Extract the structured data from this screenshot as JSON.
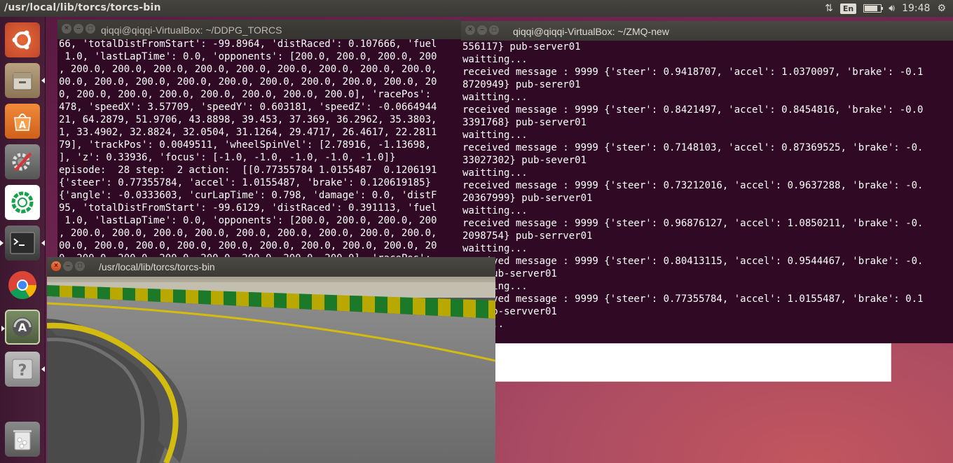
{
  "panel": {
    "title": "/usr/local/lib/torcs/torcs-bin",
    "lang": "En",
    "battery_level": 0.8,
    "volume_icon": "volume-icon",
    "clock": "19:48",
    "network_icon": "network-updown-icon",
    "power_icon": "power-gear-icon"
  },
  "launcher": [
    {
      "name": "ubuntu-dash-icon"
    },
    {
      "name": "files-icon"
    },
    {
      "name": "software-center-icon"
    },
    {
      "name": "system-settings-icon"
    },
    {
      "name": "green-app-icon"
    },
    {
      "name": "terminal-icon"
    },
    {
      "name": "chrome-icon"
    },
    {
      "name": "software-updater-icon"
    },
    {
      "name": "help-icon"
    },
    {
      "name": "trash-icon"
    }
  ],
  "term_left": {
    "title": "qiqqi@qiqqi-VirtualBox: ~/DDPG_TORCS",
    "lines": [
      "66, 'totalDistFromStart': -99.8964, 'distRaced': 0.107666, 'fuel",
      " 1.0, 'lastLapTime': 0.0, 'opponents': [200.0, 200.0, 200.0, 200",
      ", 200.0, 200.0, 200.0, 200.0, 200.0, 200.0, 200.0, 200.0, 200.0,",
      "00.0, 200.0, 200.0, 200.0, 200.0, 200.0, 200.0, 200.0, 200.0, 20",
      "0, 200.0, 200.0, 200.0, 200.0, 200.0, 200.0, 200.0], 'racePos':",
      "478, 'speedX': 3.57709, 'speedY': 0.603181, 'speedZ': -0.0664944",
      "21, 64.2879, 51.9706, 43.8898, 39.453, 37.369, 36.2962, 35.3803,",
      "1, 33.4902, 32.8824, 32.0504, 31.1264, 29.4717, 26.4617, 22.2811",
      "79], 'trackPos': 0.0049511, 'wheelSpinVel': [2.78916, -1.13698,",
      "], 'z': 0.33936, 'focus': [-1.0, -1.0, -1.0, -1.0, -1.0]}",
      "episode:  28 step:  2 action:  [[0.77355784 1.0155487  0.1206191",
      "{'steer': 0.77355784, 'accel': 1.0155487, 'brake': 0.120619185}",
      "{'angle': -0.0333603, 'curLapTime': 0.798, 'damage': 0.0, 'distF",
      "95, 'totalDistFromStart': -99.6129, 'distRaced': 0.391113, 'fuel",
      " 1.0, 'lastLapTime': 0.0, 'opponents': [200.0, 200.0, 200.0, 200",
      ", 200.0, 200.0, 200.0, 200.0, 200.0, 200.0, 200.0, 200.0, 200.0,",
      "00.0, 200.0, 200.0, 200.0, 200.0, 200.0, 200.0, 200.0, 200.0, 20",
      "0, 200.0, 200.0, 200.0, 200.0, 200.0, 200.0, 200.0], 'racePos':"
    ]
  },
  "term_right": {
    "title": "qiqqi@qiqqi-VirtualBox: ~/ZMQ-new",
    "lines": [
      "556117} pub-server01",
      "waitting...",
      "received message : 9999 {'steer': 0.9418707, 'accel': 1.0370097, 'brake': -0.1",
      "8720949} pub-serer01",
      "waitting...",
      "received message : 9999 {'steer': 0.8421497, 'accel': 0.8454816, 'brake': -0.0",
      "3391768} pub-server01",
      "waitting...",
      "received message : 9999 {'steer': 0.7148103, 'accel': 0.87369525, 'brake': -0.",
      "33027302} pub-sever01",
      "waitting...",
      "received message : 9999 {'steer': 0.73212016, 'accel': 0.9637288, 'brake': -0.",
      "20367999} pub-server01",
      "waitting...",
      "received message : 9999 {'steer': 0.96876127, 'accel': 1.0850211, 'brake': -0.",
      "2098754} pub-serrver01",
      "waitting...",
      "received message : 9999 {'steer': 0.80413115, 'accel': 0.9544467, 'brake': -0.",
      "85} pub-server01",
      "waitting...",
      "received message : 9999 {'steer': 0.77355784, 'accel': 1.0155487, 'brake': 0.1",
      "3} pub-servver01",
      "ting..."
    ]
  },
  "torcs": {
    "title": "/usr/local/lib/torcs/torcs-bin"
  },
  "colors": {
    "terminal_bg": "#300a24",
    "panel_bg": "#3c3b37",
    "close_button": "#e4572e",
    "curb_green": "#1a7a2a",
    "curb_yellow": "#c8b400",
    "track_line": "#d4bb10"
  }
}
